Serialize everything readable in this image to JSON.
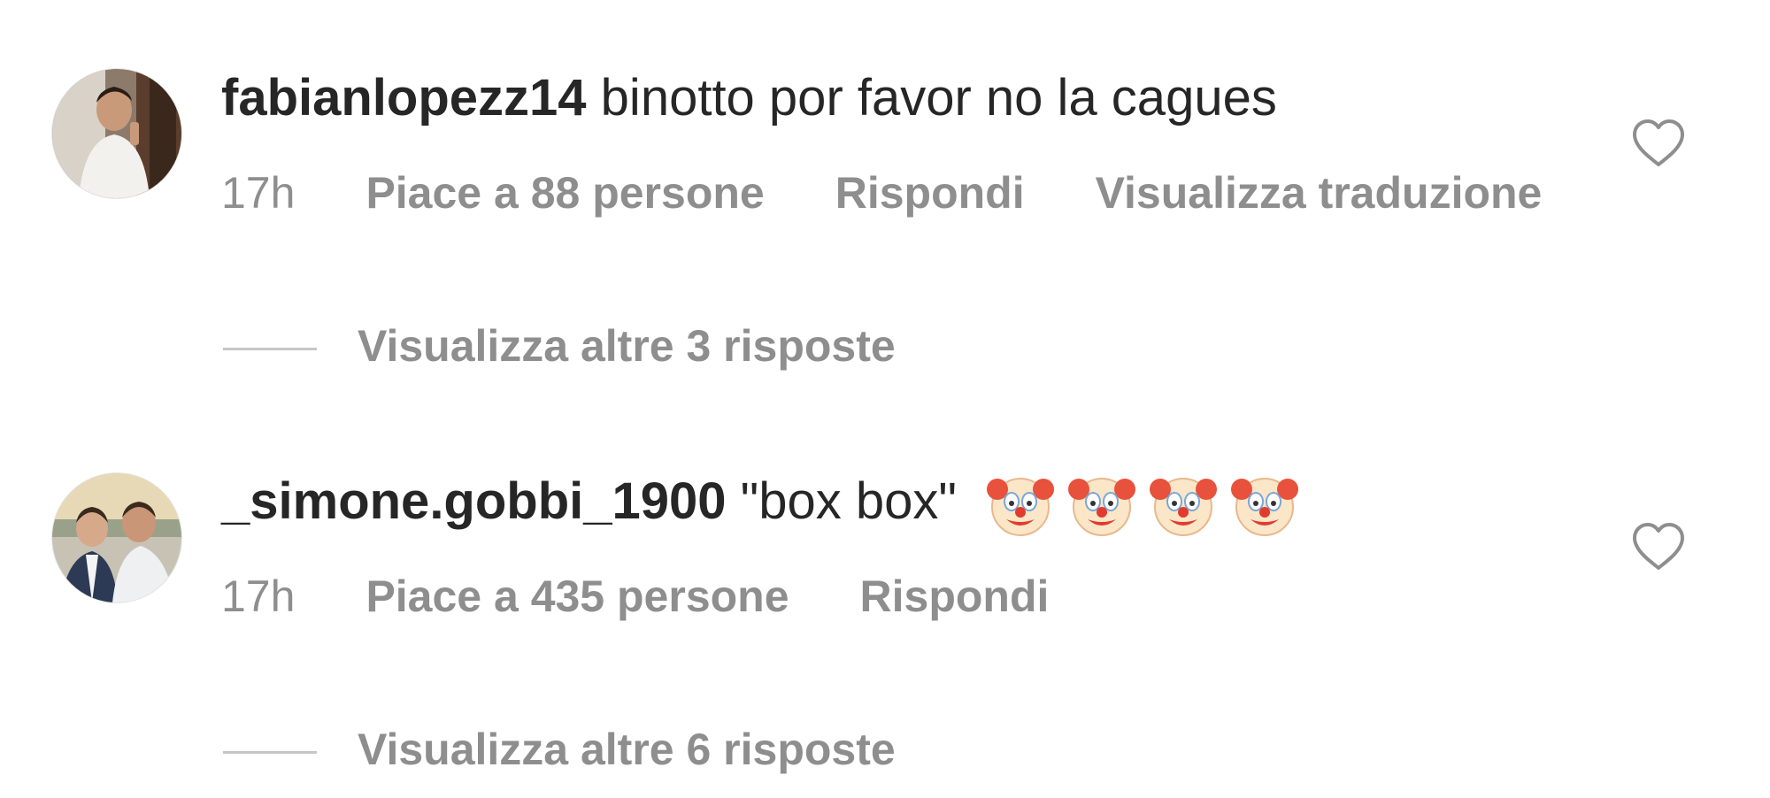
{
  "comments": [
    {
      "username": "fabianlopezz14",
      "text": "binotto por favor no la cagues",
      "emojis": [],
      "time": "17h",
      "likes": "Piace a 88 persone",
      "reply": "Rispondi",
      "translate": "Visualizza traduzione",
      "view_replies": "Visualizza altre 3 risposte",
      "avatar_icon": "person-photo-avatar",
      "like_icon": "heart-outline-icon"
    },
    {
      "username": "_simone.gobbi_1900",
      "text": "\"box box\"",
      "emojis": [
        "clown-face",
        "clown-face",
        "clown-face",
        "clown-face"
      ],
      "time": "17h",
      "likes": "Piace a 435 persone",
      "reply": "Rispondi",
      "view_replies": "Visualizza altre 6 risposte",
      "avatar_icon": "two-people-photo-avatar",
      "like_icon": "heart-outline-icon"
    }
  ],
  "colors": {
    "primary_text": "#262626",
    "secondary_text": "#8e8e8e",
    "divider": "#c7c7c7"
  }
}
